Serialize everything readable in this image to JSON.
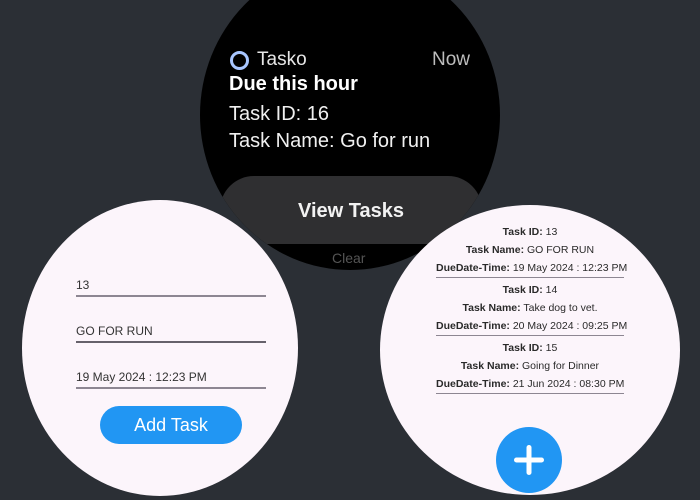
{
  "notification": {
    "app_name": "Tasko",
    "time": "Now",
    "title": "Due this hour",
    "task_id_line": "Task ID: 16",
    "task_name_line": "Task Name: Go for run",
    "action_label": "View Tasks",
    "secondary_hint": "Clear"
  },
  "add_form": {
    "task_id_value": "13",
    "task_name_value": "GO FOR RUN",
    "due_value": "19 May 2024 : 12:23 PM",
    "submit_label": "Add Task"
  },
  "task_list": {
    "labels": {
      "id": "Task ID:",
      "name": "Task Name:",
      "due": "DueDate-Time:"
    },
    "tasks": [
      {
        "id": "13",
        "name": "GO FOR RUN",
        "due": "19 May 2024 : 12:23 PM"
      },
      {
        "id": "14",
        "name": "Take dog to vet.",
        "due": "20 May 2024 : 09:25 PM"
      },
      {
        "id": "15",
        "name": "Going for Dinner",
        "due": "21 Jun 2024 : 08:30 PM"
      }
    ],
    "fab_icon": "plus-icon"
  },
  "colors": {
    "background": "#2b2f35",
    "accent": "#2196f3",
    "watch_surface": "#fcf5fb",
    "ring": "#a8c6ff"
  }
}
